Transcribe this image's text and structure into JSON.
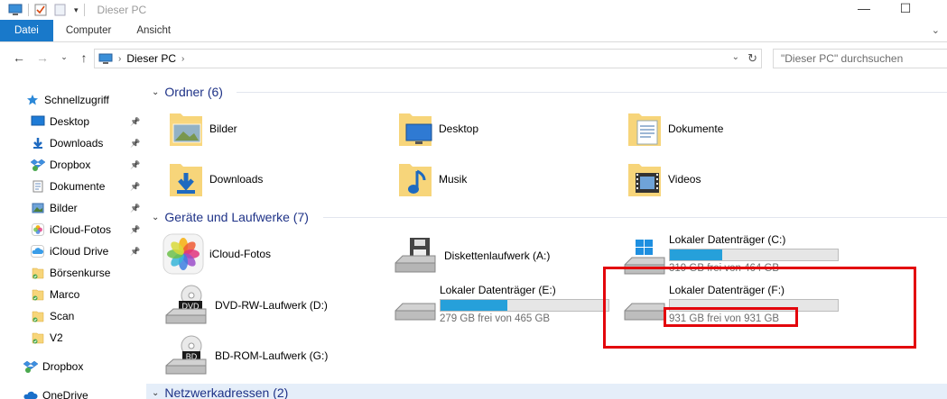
{
  "window": {
    "title": "Dieser PC",
    "minimize": "—",
    "maximize": "☐"
  },
  "ribbon": {
    "tabs": [
      {
        "label": "Datei"
      },
      {
        "label": "Computer"
      },
      {
        "label": "Ansicht"
      }
    ]
  },
  "address": {
    "path": "Dieser PC",
    "search_placeholder": "\"Dieser PC\" durchsuchen"
  },
  "sidebar": {
    "items": [
      {
        "label": "Schnellzugriff",
        "icon": "star-icon",
        "pinned": false
      },
      {
        "label": "Desktop",
        "icon": "desktop-icon",
        "pinned": true
      },
      {
        "label": "Downloads",
        "icon": "download-icon",
        "pinned": true
      },
      {
        "label": "Dropbox",
        "icon": "dropbox-icon",
        "pinned": true
      },
      {
        "label": "Dokumente",
        "icon": "document-icon",
        "pinned": true
      },
      {
        "label": "Bilder",
        "icon": "pictures-icon",
        "pinned": true
      },
      {
        "label": "iCloud-Fotos",
        "icon": "photos-icon",
        "pinned": true
      },
      {
        "label": "iCloud Drive",
        "icon": "cloud-icon",
        "pinned": true
      },
      {
        "label": "Börsenkurse",
        "icon": "folder-icon",
        "pinned": false
      },
      {
        "label": "Marco",
        "icon": "folder-icon",
        "pinned": false
      },
      {
        "label": "Scan",
        "icon": "folder-icon",
        "pinned": false
      },
      {
        "label": "V2",
        "icon": "folder-icon",
        "pinned": false
      },
      {
        "label": "Dropbox",
        "icon": "dropbox-icon",
        "pinned": false
      },
      {
        "label": "OneDrive",
        "icon": "onedrive-icon",
        "pinned": false
      }
    ]
  },
  "groups": {
    "folders_title": "Ordner (6)",
    "devices_title": "Geräte und Laufwerke (7)",
    "network_title": "Netzwerkadressen (2)"
  },
  "folders": [
    {
      "label": "Bilder"
    },
    {
      "label": "Desktop"
    },
    {
      "label": "Dokumente"
    },
    {
      "label": "Downloads"
    },
    {
      "label": "Musik"
    },
    {
      "label": "Videos"
    }
  ],
  "devices": {
    "icloud": {
      "label": "iCloud-Fotos"
    },
    "floppy": {
      "label": "Diskettenlaufwerk (A:)"
    },
    "dvd": {
      "label": "DVD-RW-Laufwerk (D:)",
      "badge": "DVD"
    },
    "bd": {
      "label": "BD-ROM-Laufwerk (G:)",
      "badge": "BD"
    },
    "drive_c": {
      "label": "Lokaler Datenträger (C:)",
      "free": "319 GB frei von 464 GB",
      "used_fraction": 0.31
    },
    "drive_e": {
      "label": "Lokaler Datenträger (E:)",
      "free": "279 GB frei von 465 GB",
      "used_fraction": 0.4
    },
    "drive_f": {
      "label": "Lokaler Datenträger (F:)",
      "free": "931 GB frei von 931 GB",
      "used_fraction": 0.0
    }
  },
  "colors": {
    "accent": "#1979ca",
    "group_header": "#1e3287",
    "drive_fill": "#26a0da",
    "annotation": "#e3050c"
  }
}
